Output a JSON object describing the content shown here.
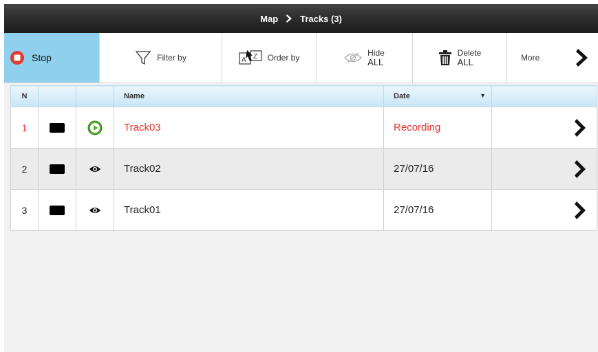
{
  "titlebar": {
    "crumb_parent": "Map",
    "crumb_current": "Tracks (3)"
  },
  "toolbar": {
    "stop": "Stop",
    "filter": "Filter by",
    "order": "Order by",
    "hide_line1": "Hide",
    "hide_line2": "ALL",
    "delete_line1": "Delete",
    "delete_line2": "ALL",
    "more": "More"
  },
  "table": {
    "headers": {
      "n": "N",
      "name": "Name",
      "date": "Date"
    },
    "rows": [
      {
        "n": "1",
        "name": "Track03",
        "date": "Recording",
        "color": "#000000",
        "status_icon": "play-circle-icon"
      },
      {
        "n": "2",
        "name": "Track02",
        "date": "27/07/16",
        "color": "#000000",
        "status_icon": "eye-icon"
      },
      {
        "n": "3",
        "name": "Track01",
        "date": "27/07/16",
        "color": "#000000",
        "status_icon": "eye-icon"
      }
    ]
  },
  "colors": {
    "accent": "#8fd0ee",
    "recording": "#e5322b",
    "play": "#5aa832"
  }
}
